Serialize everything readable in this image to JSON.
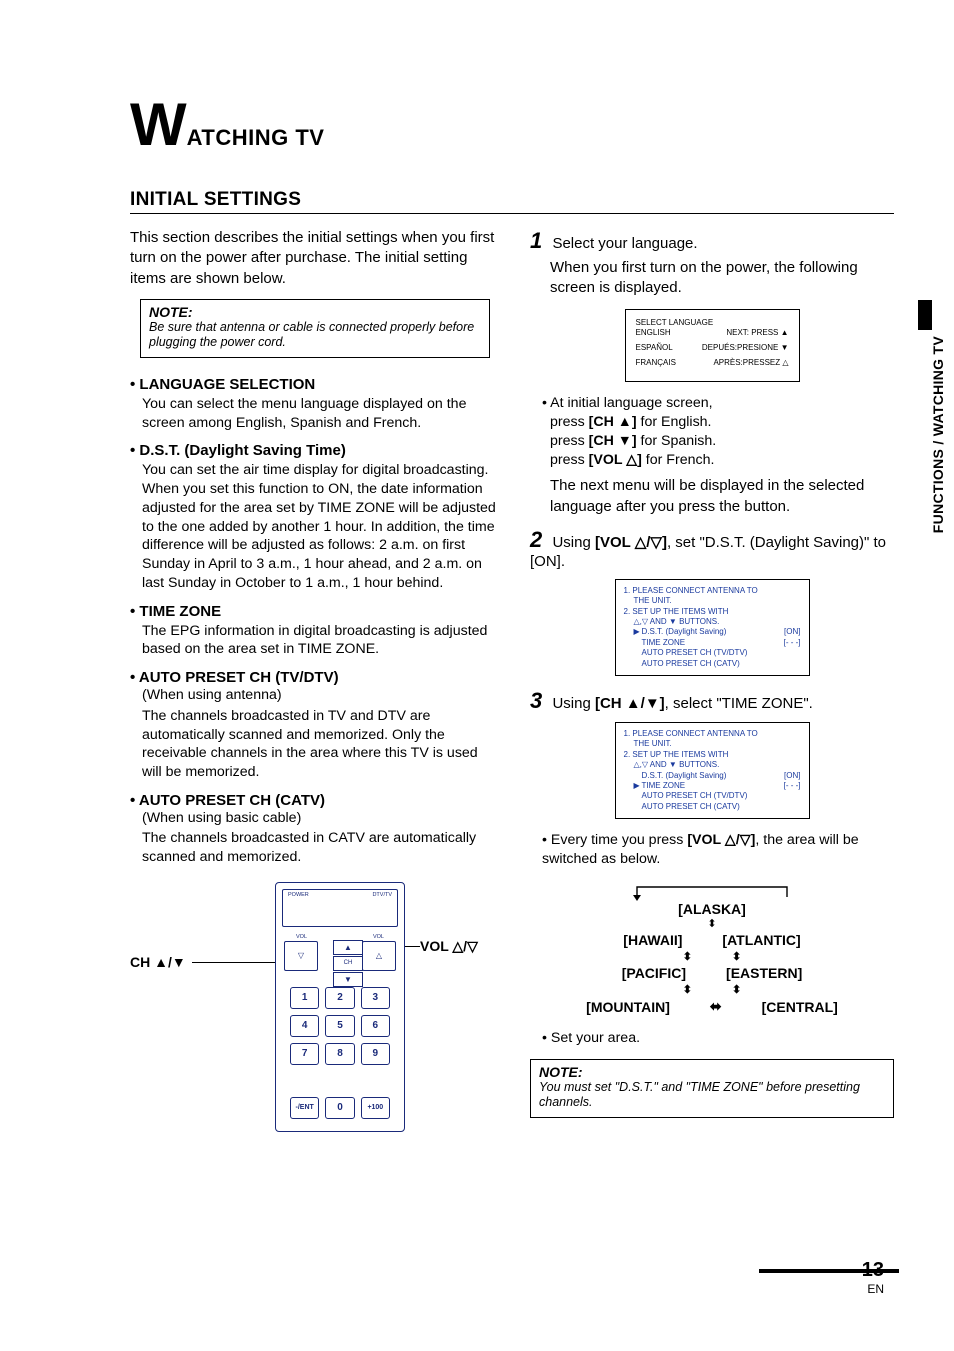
{
  "title": {
    "big": "W",
    "rest": "ATCHING TV"
  },
  "section_title": "INITIAL SETTINGS",
  "intro": "This section describes the initial settings when you first turn on the power after purchase. The initial setting items are shown below.",
  "note1": {
    "head": "NOTE:",
    "body": "Be sure that antenna or cable is connected properly before plugging the power cord."
  },
  "left": {
    "lang_sel": {
      "head": "• LANGUAGE SELECTION",
      "body": "You can select the menu language displayed on the screen among English, Spanish and French."
    },
    "dst": {
      "head": "• D.S.T. (Daylight Saving Time)",
      "body": "You can set the air time display for digital broadcasting. When you set this function to ON, the date information adjusted for the area set by TIME ZONE will be adjusted to the one added by another 1 hour. In addition, the time difference will be adjusted as follows: 2 a.m. on first Sunday in April to 3 a.m., 1 hour ahead, and 2 a.m. on last Sunday in October to 1 a.m., 1 hour behind."
    },
    "tz": {
      "head": "• TIME ZONE",
      "body": "The EPG information in digital broadcasting is adjusted based on the area set in TIME ZONE."
    },
    "ap_tv": {
      "head": "• AUTO PRESET CH (TV/DTV)",
      "sub": "(When using antenna)",
      "body": "The channels broadcasted in TV and DTV are automatically scanned and memorized. Only the receivable channels in the area where this TV is used will be memorized."
    },
    "ap_catv": {
      "head": "• AUTO PRESET CH (CATV)",
      "sub": "(When using basic cable)",
      "body": "The channels broadcasted in CATV are automatically scanned and memorized."
    }
  },
  "remote": {
    "label_ch": "CH ▲/▼",
    "label_vol": "VOL △/▽",
    "power": "POWER",
    "dtvtv": "DTV/TV",
    "vol": "VOL",
    "ch": "CH",
    "nums": [
      "1",
      "2",
      "3",
      "4",
      "5",
      "6",
      "7",
      "8",
      "9"
    ],
    "bot": [
      "-/ENT",
      "0",
      "+100"
    ]
  },
  "step1": {
    "num": "1",
    "line": "Select your language.",
    "body": "When you first turn on the power, the following screen is displayed.",
    "osd": {
      "title": "SELECT LANGUAGE",
      "r1a": "ENGLISH",
      "r1b": "NEXT: PRESS ▲",
      "r2a": "ESPAÑOL",
      "r2b": "DEPUÉS:PRESIONE ▼",
      "r3a": "FRANÇAIS",
      "r3b": "APRÈS:PRESSEZ △"
    },
    "bullets": {
      "b0": "• At initial language screen,",
      "b1a": "press ",
      "b1b": "[CH ▲]",
      "b1c": " for English.",
      "b2a": "press ",
      "b2b": "[CH ▼]",
      "b2c": " for Spanish.",
      "b3a": "press ",
      "b3b": "[VOL △]",
      "b3c": " for French.",
      "after": "The next menu will be displayed in the selected language after you press the button."
    }
  },
  "step2": {
    "num": "2",
    "line_a": "Using ",
    "line_b": "[VOL △/▽]",
    "line_c": ", set \"D.S.T. (Daylight Saving)\" to [ON].",
    "osd": {
      "l1": "1. PLEASE CONNECT ANTENNA TO",
      "l1b": "THE UNIT.",
      "l2": "2. SET UP THE ITEMS WITH",
      "l2b": "△,▽ AND ▼ BUTTONS.",
      "i1": "D.S.T. (Daylight Saving)",
      "v1": "[ON]",
      "i2": "TIME ZONE",
      "v2": "[- - -]",
      "i3": "AUTO PRESET CH (TV/DTV)",
      "i4": "AUTO PRESET CH (CATV)"
    }
  },
  "step3": {
    "num": "3",
    "line_a": "Using ",
    "line_b": "[CH ▲/▼]",
    "line_c": ", select \"TIME ZONE\".",
    "osd": {
      "l1": "1. PLEASE CONNECT ANTENNA TO",
      "l1b": "THE UNIT.",
      "l2": "2. SET UP THE ITEMS WITH",
      "l2b": "△,▽ AND ▼ BUTTONS.",
      "i1": "D.S.T. (Daylight Saving)",
      "v1": "[ON]",
      "i2": "TIME ZONE",
      "v2": "[- - -]",
      "i3": "AUTO PRESET CH (TV/DTV)",
      "i4": "AUTO PRESET CH (CATV)"
    },
    "bul_a": "• Every time you press ",
    "bul_b": "[VOL △/▽]",
    "bul_c": ", the area will be switched as below.",
    "zones": {
      "alaska": "[ALASKA]",
      "hawaii": "[HAWAII]",
      "atlantic": "[ATLANTIC]",
      "pacific": "[PACIFIC]",
      "eastern": "[EASTERN]",
      "mountain": "[MOUNTAIN]",
      "central": "[CENTRAL]"
    },
    "setarea": "• Set your area."
  },
  "note2": {
    "head": "NOTE:",
    "body": "You must set \"D.S.T.\" and \"TIME ZONE\" before presetting channels."
  },
  "sidebar": "FUNCTIONS / WATCHING TV",
  "pagenum": {
    "num": "13",
    "lang": "EN"
  }
}
